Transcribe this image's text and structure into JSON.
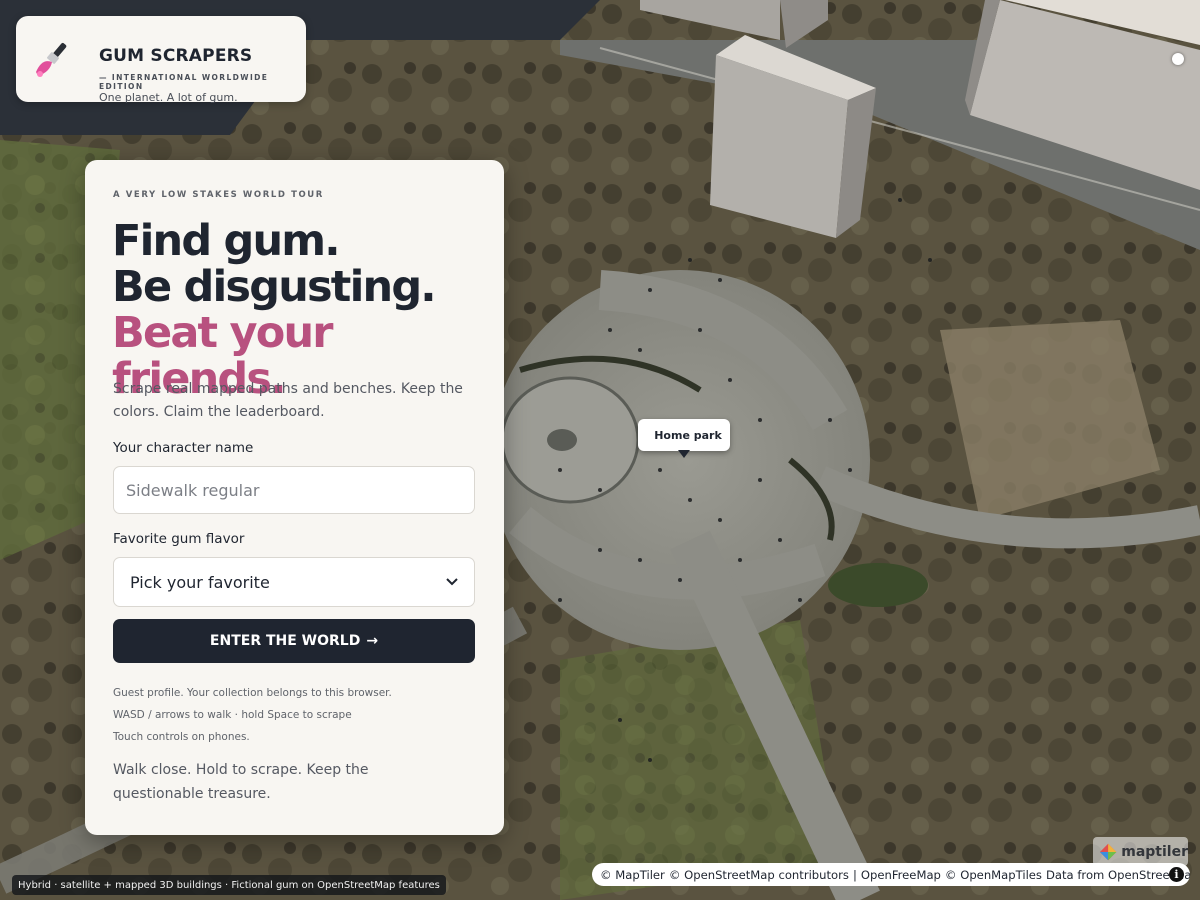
{
  "brand": {
    "title": "GUM SCRAPERS",
    "edition": "— INTERNATIONAL WORLDWIDE EDITION",
    "tagline": "One planet. A lot of gum.",
    "logo_icon": "paint-scraper-icon"
  },
  "panel": {
    "eyebrow": "A VERY LOW STAKES WORLD TOUR",
    "hero_line1": "Find gum.",
    "hero_line2": "Be disgusting.",
    "hero_line3": "Beat your friends.",
    "blurb": "Scrape real mapped paths and benches. Keep the colors. Claim the leaderboard.",
    "name_label": "Your character name",
    "name_placeholder": "Sidewalk regular",
    "name_value": "",
    "flavor_label": "Favorite gum flavor",
    "flavor_selected": "Pick your favorite",
    "enter_label": "ENTER THE WORLD",
    "enter_arrow": "→",
    "notes": [
      "Guest profile. Your collection belongs to this browser.",
      "WASD / arrows to walk · hold Space to scrape",
      "Touch controls on phones."
    ],
    "closing": "Walk close. Hold to scrape. Keep the questionable treasure."
  },
  "map": {
    "marker_label": "Home park",
    "layer_note": "Hybrid · satellite + mapped 3D buildings · Fictional gum on OpenStreetMap features",
    "logo_text": "maptiler",
    "attribution": [
      "© MapTiler",
      "© OpenStreetMap contributors",
      "|",
      "OpenFreeMap",
      "© OpenMapTiles",
      "Data from OpenStreetMap"
    ],
    "info_icon": "i"
  },
  "colors": {
    "accent_pink": "#b8517f",
    "dark": "#1f2530",
    "panel_bg": "#f8f6f2"
  }
}
